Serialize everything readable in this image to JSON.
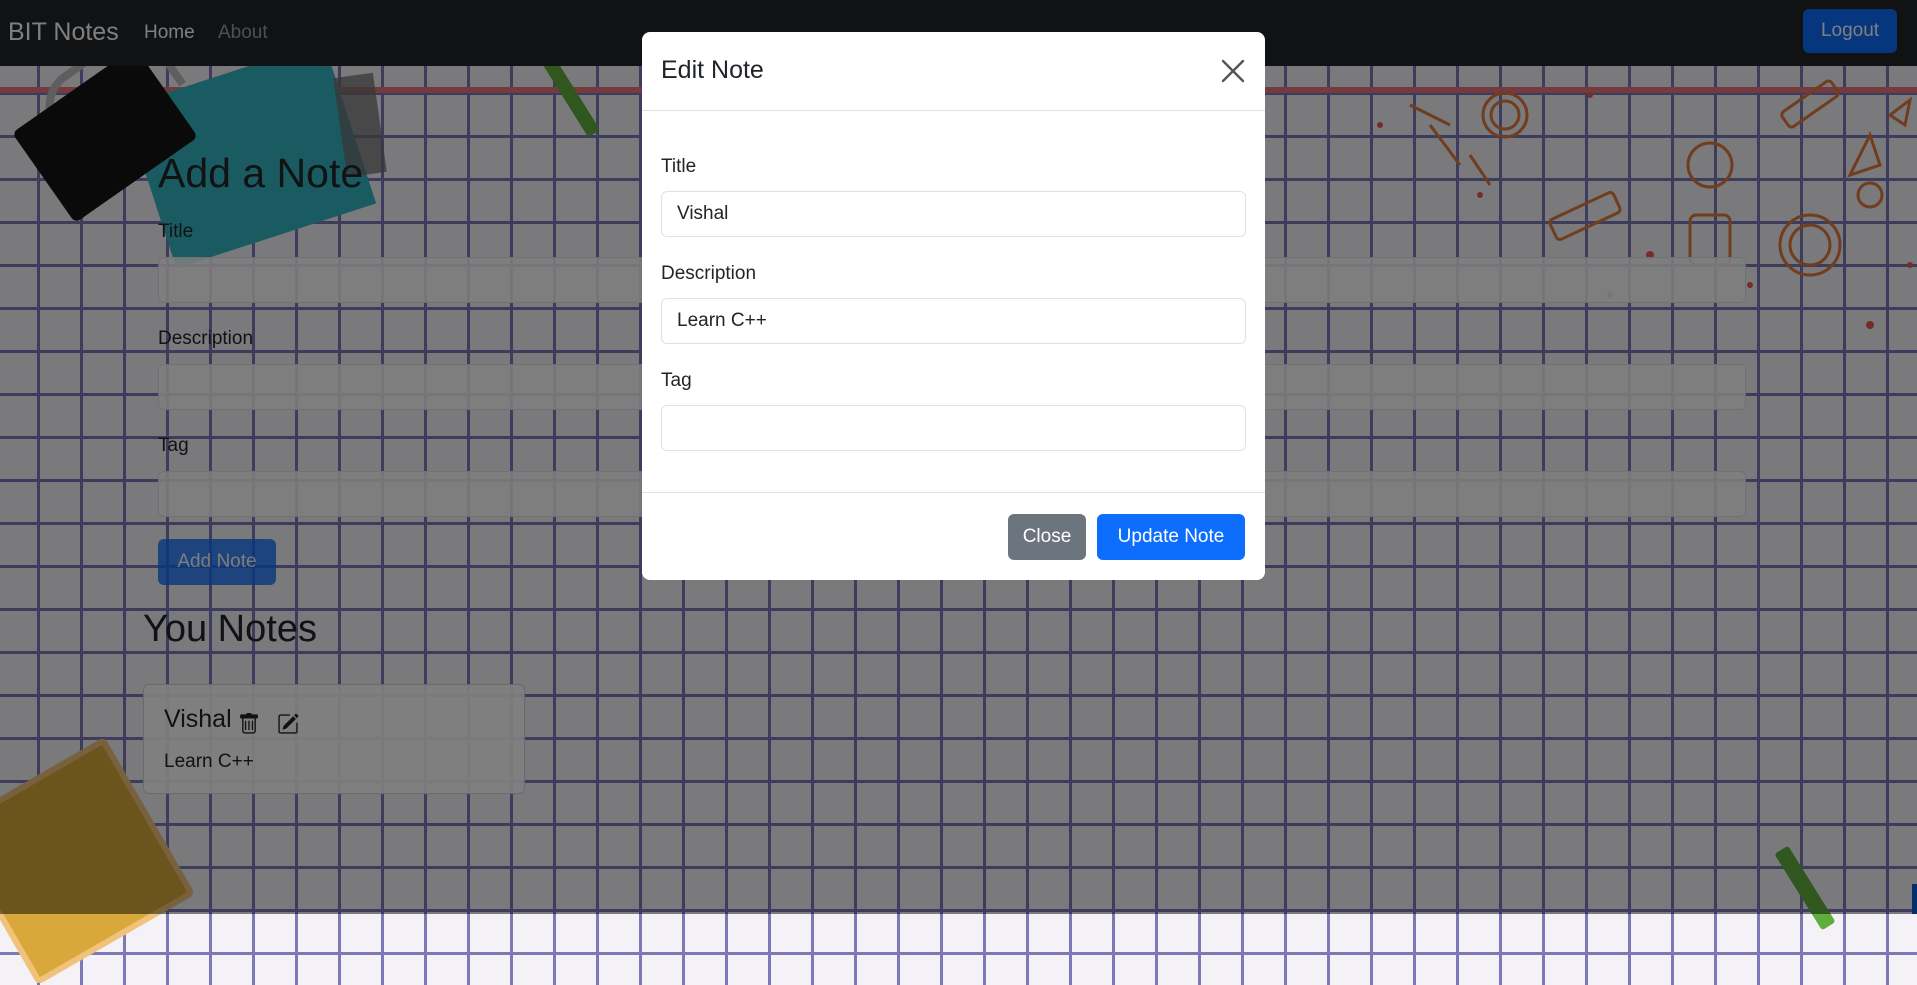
{
  "navbar": {
    "brand": "BIT Notes",
    "links": [
      {
        "label": "Home",
        "active": true
      },
      {
        "label": "About",
        "active": false
      }
    ],
    "logout_label": "Logout"
  },
  "add_note": {
    "heading": "Add a Note",
    "title_label": "Title",
    "description_label": "Description",
    "tag_label": "Tag",
    "submit_label": "Add Note"
  },
  "notes_section": {
    "heading": "You Notes",
    "notes": [
      {
        "title": "Vishal",
        "description": "Learn C++",
        "icons": [
          "trash-icon",
          "edit-icon"
        ]
      }
    ]
  },
  "modal": {
    "title": "Edit Note",
    "close_icon": "close-icon",
    "fields": {
      "title": {
        "label": "Title",
        "value": "Vishal"
      },
      "description": {
        "label": "Description",
        "value": "Learn C++"
      },
      "tag": {
        "label": "Tag",
        "value": ""
      }
    },
    "close_label": "Close",
    "update_label": "Update Note"
  },
  "colors": {
    "primary": "#0d6efd",
    "secondary": "#6c757d",
    "navbar": "#212529",
    "grid_line": "#7d78b8"
  }
}
